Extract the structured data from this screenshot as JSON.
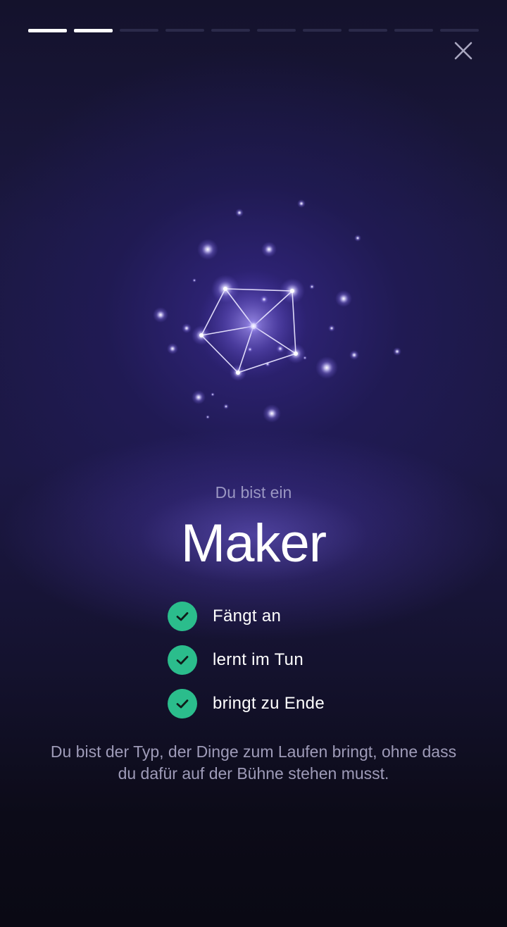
{
  "progress": {
    "total_steps": 10,
    "completed_steps": 2
  },
  "header": {
    "close_icon": "close-icon"
  },
  "illustration": {
    "icon": "constellation-icon"
  },
  "result": {
    "intro": "Du bist ein",
    "type_name": "Maker"
  },
  "traits": [
    {
      "label": "Fängt an",
      "icon": "check-icon"
    },
    {
      "label": "lernt im Tun",
      "icon": "check-icon"
    },
    {
      "label": "bringt zu Ende",
      "icon": "check-icon"
    }
  ],
  "description": "Du bist der Typ, der Dinge zum Laufen bringt, ohne dass du dafür auf der Bühne stehen musst.",
  "colors": {
    "accent_check": "#2bbd8c",
    "progress_done": "#ffffff",
    "progress_pending": "#2b2a4a"
  }
}
